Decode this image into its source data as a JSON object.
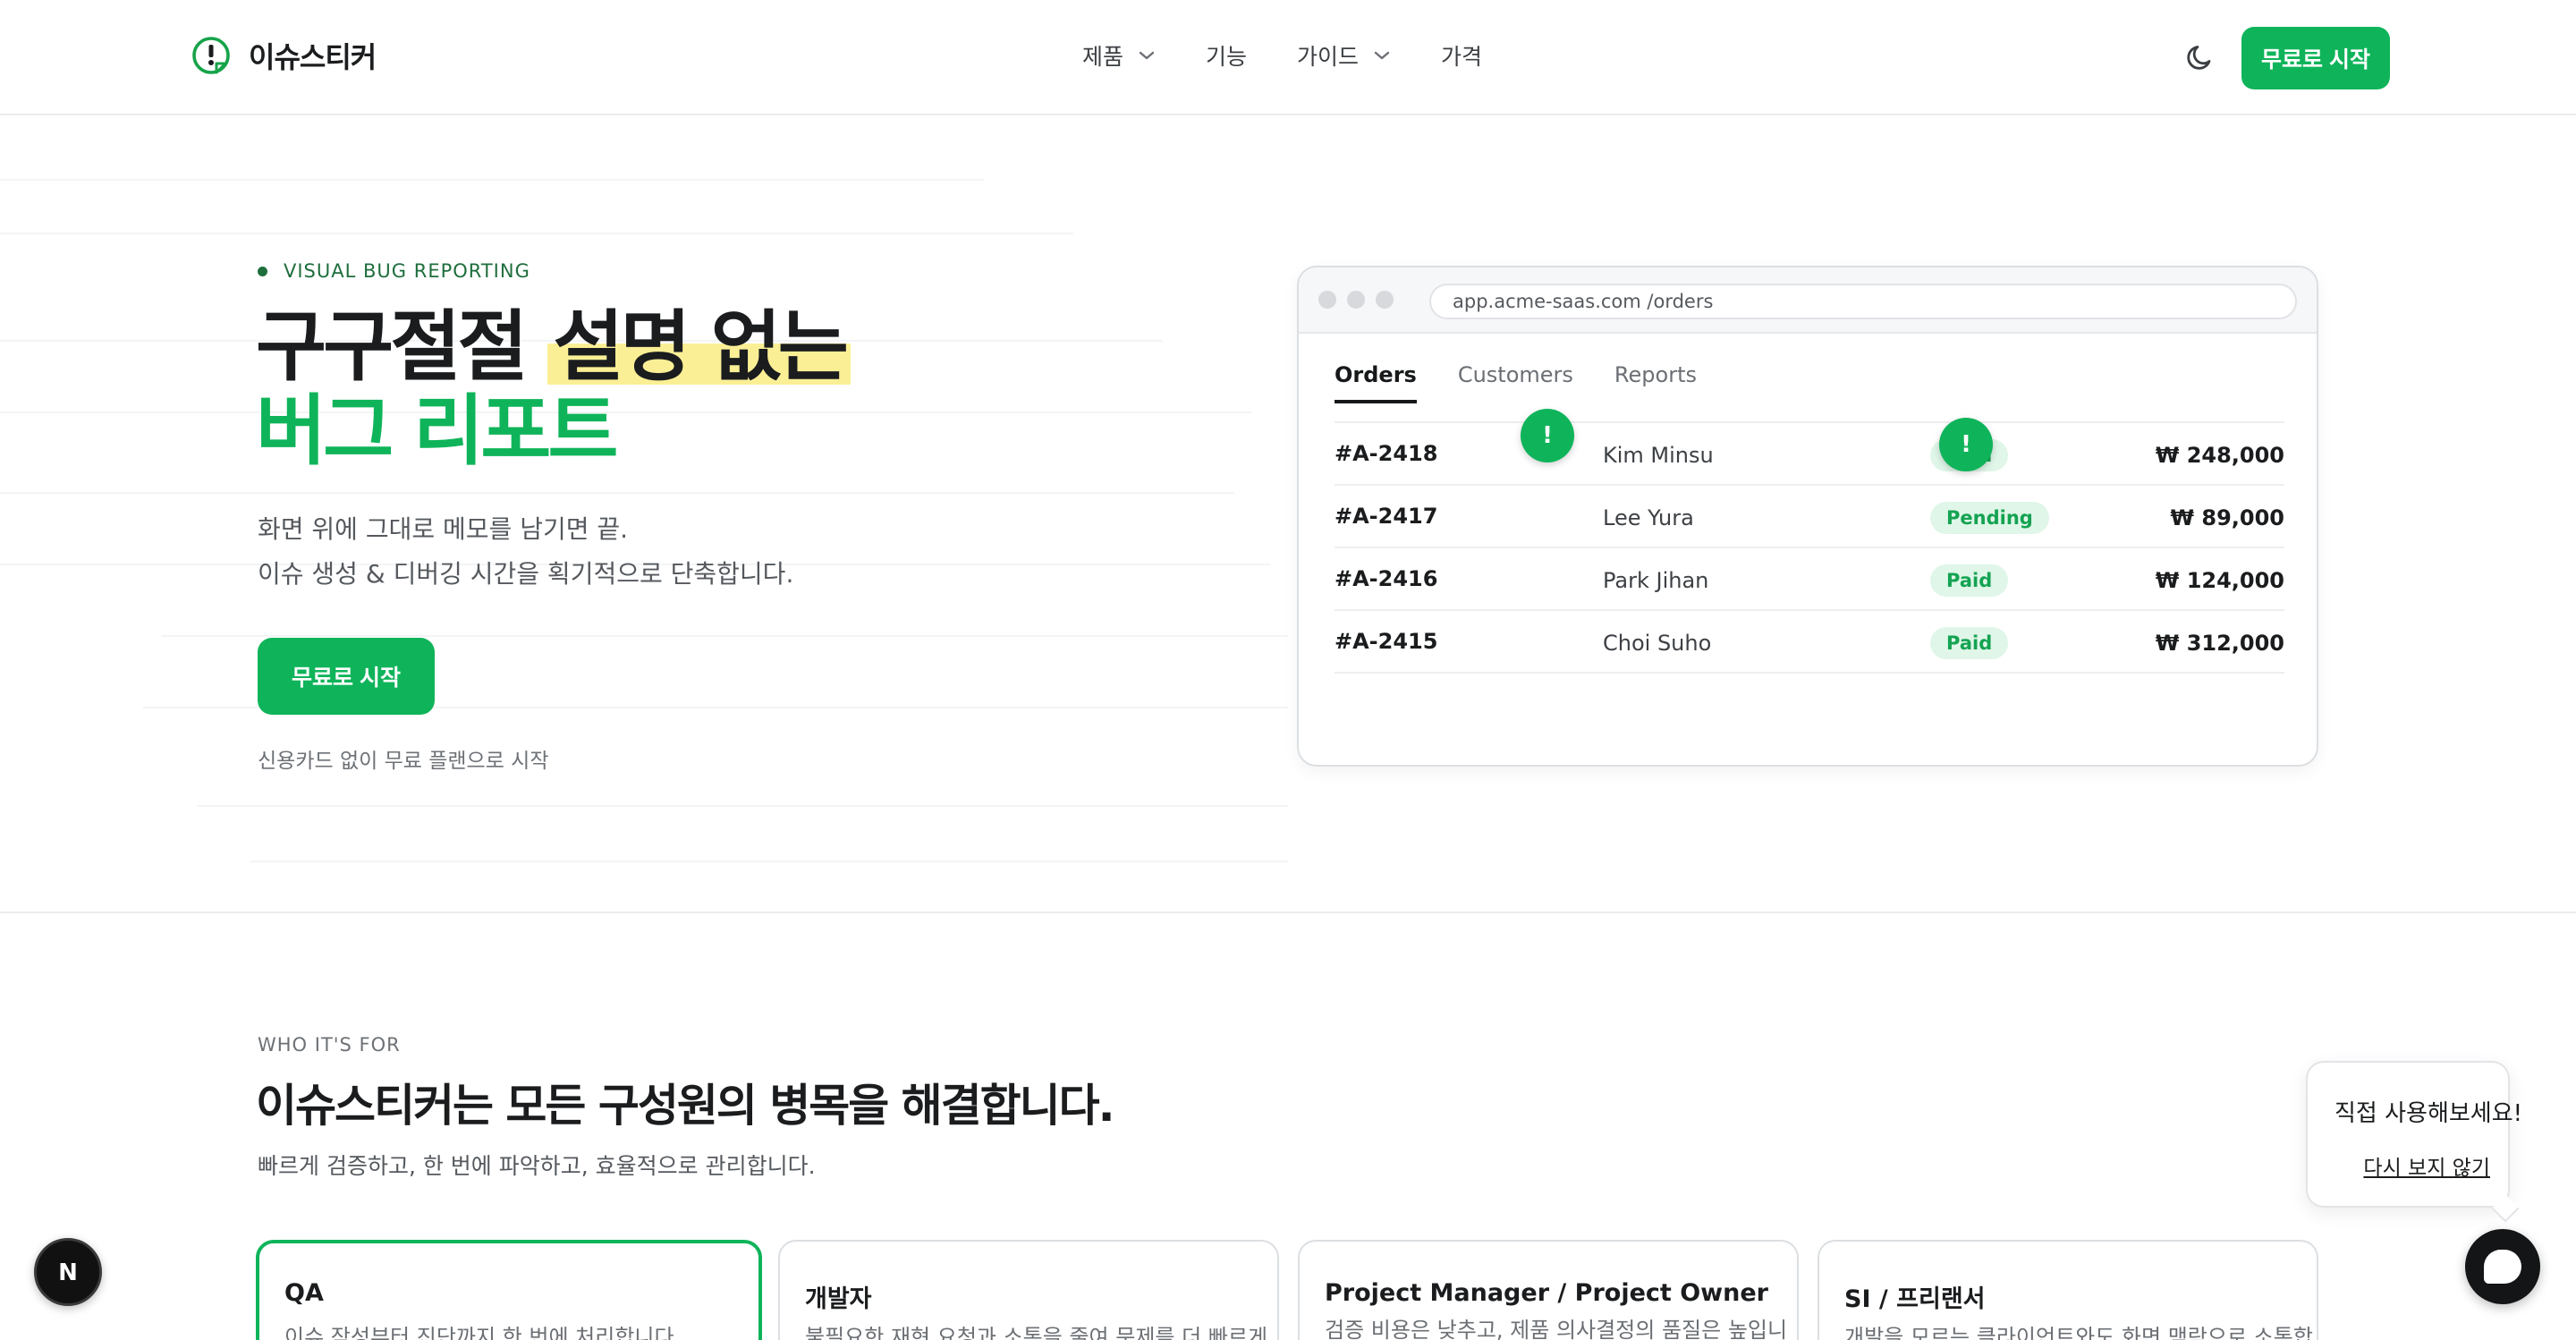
{
  "header": {
    "brand": "이슈스티커",
    "nav": [
      {
        "label": "제품",
        "has_dropdown": true
      },
      {
        "label": "기능",
        "has_dropdown": false
      },
      {
        "label": "가이드",
        "has_dropdown": true
      },
      {
        "label": "가격",
        "has_dropdown": false
      }
    ],
    "theme_icon": "moon-icon",
    "cta_label": "무료로 시작"
  },
  "hero": {
    "eyebrow": "VISUAL BUG REPORTING",
    "headline_plain": "구구절절 ",
    "headline_highlight": "설명 없는",
    "headline_green": "버그 리포트",
    "sub_line1": "화면 위에 그대로 메모를 남기면 끝.",
    "sub_line2": "이슈 생성 & 디버깅 시간을 획기적으로 단축합니다.",
    "cta_label": "무료로 시작",
    "note": "신용카드 없이 무료 플랜으로 시작"
  },
  "browser": {
    "url": "app.acme-saas.com /orders",
    "tabs": [
      "Orders",
      "Customers",
      "Reports"
    ],
    "active_tab": "Orders",
    "pin_label": "!",
    "orders": [
      {
        "id": "#A-2418",
        "customer": "Kim Minsu",
        "status": "Paid",
        "amount": "₩ 248,000"
      },
      {
        "id": "#A-2417",
        "customer": "Lee Yura",
        "status": "Pending",
        "amount": "₩ 89,000"
      },
      {
        "id": "#A-2416",
        "customer": "Park Jihan",
        "status": "Paid",
        "amount": "₩ 124,000"
      },
      {
        "id": "#A-2415",
        "customer": "Choi Suho",
        "status": "Paid",
        "amount": "₩ 312,000"
      }
    ]
  },
  "who": {
    "eyebrow": "WHO IT'S FOR",
    "title": "이슈스티커는 모든 구성원의 병목을 해결합니다.",
    "sub": "빠르게 검증하고, 한 번에 파악하고, 효율적으로 관리합니다.",
    "cards": [
      {
        "title": "QA",
        "desc": "이슈 작성부터 진단까지 한 번에 처리합니다."
      },
      {
        "title": "개발자",
        "desc": "불필요한 재현 요청과 소통을 줄여 문제를 더 빠르게"
      },
      {
        "title": "Project Manager / Project Owner",
        "desc": "검증 비용은 낮추고, 제품 의사결정의 품질은 높입니"
      },
      {
        "title": "SI / 프리랜서",
        "desc": "개발을 모르는 클라이언트와도 화면 맥락으로 소통합"
      }
    ]
  },
  "widget": {
    "title": "직접 사용해보세요!",
    "dismiss": "다시 보지 않기"
  },
  "devtools_badge": "N",
  "colors": {
    "accent": "#0fb45a",
    "highlight": "#fbef96",
    "badge_bg": "#dff6e8"
  }
}
